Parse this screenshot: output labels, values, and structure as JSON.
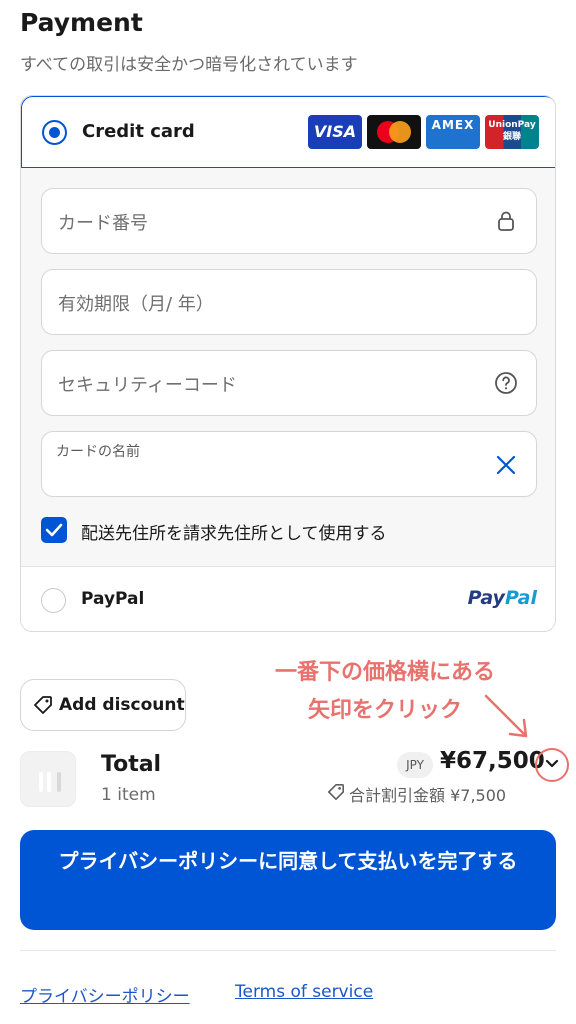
{
  "header": {
    "title": "Payment",
    "subtitle": "すべての取引は安全かつ暗号化されています"
  },
  "card_option": {
    "label": "Credit card",
    "selected": true,
    "brands": {
      "visa": "VISA",
      "amex": "AMEX",
      "unionpay_line1": "UnionPay",
      "unionpay_line2": "銀聯"
    }
  },
  "fields": {
    "card_number_placeholder": "カード番号",
    "expiry_placeholder": "有効期限（月/ 年）",
    "security_code_placeholder": "セキュリティーコード",
    "card_name_label": "カードの名前",
    "card_name_value": ""
  },
  "billing": {
    "checked": true,
    "label": "配送先住所を請求先住所として使用する"
  },
  "paypal_option": {
    "label": "PayPal",
    "logo_part1": "Pay",
    "logo_part2": "Pal",
    "selected": false
  },
  "annotation": {
    "line1": "一番下の価格横にある",
    "line2": "矢印をクリック",
    "color": "#e8726d"
  },
  "discount": {
    "button_label": "Add discount"
  },
  "summary": {
    "total_label": "Total",
    "item_count": "1 item",
    "currency": "JPY",
    "price": "¥67,500",
    "discount_total": "合計割引金額 ¥7,500"
  },
  "pay_button": {
    "label": "プライバシーポリシーに同意して支払いを完了する"
  },
  "footer": {
    "privacy_link": "プライバシーポリシー",
    "terms_link": "Terms of service"
  },
  "colors": {
    "accent": "#0055d4",
    "link": "#1a56c7",
    "annotation": "#e8726d"
  }
}
